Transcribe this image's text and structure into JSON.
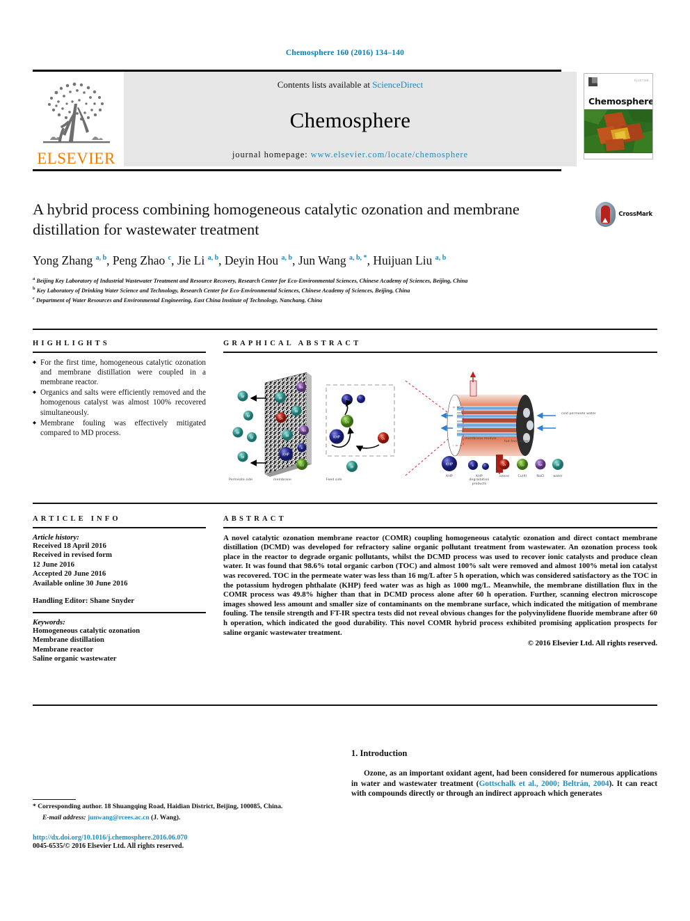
{
  "running_head": "Chemosphere 160 (2016) 134–140",
  "masthead": {
    "contents_prefix": "Contents lists available at ",
    "contents_link": "ScienceDirect",
    "journal_name": "Chemosphere",
    "homepage_prefix": "journal homepage: ",
    "homepage_url": "www.elsevier.com/locate/chemosphere",
    "publisher_logo_word": "ELSEVIER",
    "cover_title": "Chemosphere",
    "cover_publisher": "ELSEVIER"
  },
  "title": "A hybrid process combining homogeneous catalytic ozonation and membrane distillation for wastewater treatment",
  "crossmark_label": "CrossMark",
  "authors_html": "Yong Zhang <sup>a, b</sup>, Peng Zhao <sup>c</sup>, Jie Li <sup>a, b</sup>, Deyin Hou <sup>a, b</sup>, Jun Wang <sup>a, b, *</sup>, Huijuan Liu <sup>a, b</sup>",
  "affiliations": [
    {
      "mark": "a",
      "text": "Beijing Key Laboratory of Industrial Wastewater Treatment and Resource Recovery, Research Center for Eco-Environmental Sciences, Chinese Academy of Sciences, Beijing, China"
    },
    {
      "mark": "b",
      "text": "Key Laboratory of Drinking Water Science and Technology, Research Center for Eco-Environmental Sciences, Chinese Academy of Sciences, Beijing, China"
    },
    {
      "mark": "c",
      "text": "Department of Water Resources and Environmental Engineering, East China Institute of Technology, Nanchang, China"
    }
  ],
  "highlights": {
    "heading": "HIGHLIGHTS",
    "items": [
      "For the first time, homogeneous catalytic ozonation and membrane distillation were coupled in a membrane reactor.",
      "Organics and salts were efficiently removed and the homogenous catalyst was almost 100% recovered simultaneously.",
      "Membrane fouling was effectively mitigated compared to MD process."
    ]
  },
  "graphical_abstract": {
    "heading": "GRAPHICAL ABSTRACT",
    "labels": {
      "permeate_side": "Permeate side",
      "membrane": "membrane",
      "feed_side": "Feed side",
      "membrane_module": "membrane module",
      "cold_permeate_water": "cold permeate water",
      "hot_feed_water": "hot feed water"
    },
    "legend": [
      {
        "name": "KHP",
        "color": "#2a2f9e"
      },
      {
        "name": "KHP degradation products",
        "color": "#2a2f9e"
      },
      {
        "name": "ozone",
        "color": "#c9261c"
      },
      {
        "name": "Cu(II)",
        "color": "#64a82a"
      },
      {
        "name": "NaCl",
        "color": "#8b5ab4"
      },
      {
        "name": "water",
        "color": "#3fa8a0"
      }
    ]
  },
  "article_info": {
    "heading": "ARTICLE INFO",
    "history_label": "Article history:",
    "history": [
      "Received 18 April 2016",
      "Received in revised form",
      "12 June 2016",
      "Accepted 20 June 2016",
      "Available online 30 June 2016"
    ],
    "handling_editor": "Handling Editor: Shane Snyder",
    "keywords_label": "Keywords:",
    "keywords": [
      "Homogeneous catalytic ozonation",
      "Membrane distillation",
      "Membrane reactor",
      "Saline organic wastewater"
    ]
  },
  "abstract": {
    "heading": "ABSTRACT",
    "body": "A novel catalytic ozonation membrane reactor (COMR) coupling homogeneous catalytic ozonation and direct contact membrane distillation (DCMD) was developed for refractory saline organic pollutant treatment from wastewater. An ozonation process took place in the reactor to degrade organic pollutants, whilst the DCMD process was used to recover ionic catalysts and produce clean water. It was found that 98.6% total organic carbon (TOC) and almost 100% salt were removed and almost 100% metal ion catalyst was recovered. TOC in the permeate water was less than 16 mg/L after 5 h operation, which was considered satisfactory as the TOC in the potassium hydrogen phthalate (KHP) feed water was as high as 1000 mg/L. Meanwhile, the membrane distillation flux in the COMR process was 49.8% higher than that in DCMD process alone after 60 h operation. Further, scanning electron microscope images showed less amount and smaller size of contaminants on the membrane surface, which indicated the mitigation of membrane fouling. The tensile strength and FT-IR spectra tests did not reveal obvious changes for the polyvinylidene fluoride membrane after 60 h operation, which indicated the good durability. This novel COMR hybrid process exhibited promising application prospects for saline organic wastewater treatment.",
    "copyright": "© 2016 Elsevier Ltd. All rights reserved."
  },
  "introduction": {
    "heading": "1. Introduction",
    "paragraph_pre": "Ozone, as an important oxidant agent, had been considered for numerous applications in water and wastewater treatment (",
    "citation": "Gottschalk et al., 2000; Beltrán, 2004",
    "paragraph_post": "). It can react with compounds directly or through an indirect approach which generates"
  },
  "footer": {
    "corresponding": "* Corresponding author. 18 Shuangqing Road, Haidian District, Beijing, 100085, China.",
    "email_label": "E-mail address:",
    "email": "junwang@rcees.ac.cn",
    "email_suffix": "(J. Wang).",
    "doi": "http://dx.doi.org/10.1016/j.chemosphere.2016.06.070",
    "issn": "0045-6535/© 2016 Elsevier Ltd. All rights reserved."
  }
}
